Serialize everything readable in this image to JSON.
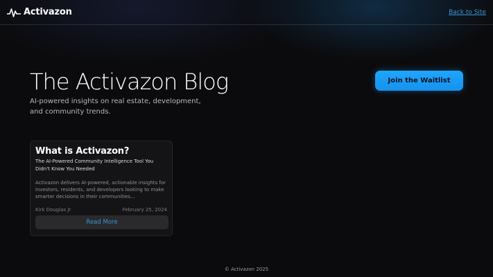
{
  "header": {
    "brand_name": "Activazon",
    "logo_icon": "pulse-wave-icon",
    "back_link": "Back to Site"
  },
  "hero": {
    "title": "The Activazon Blog",
    "subtitle": "AI-powered insights on real estate, development, and community trends.",
    "cta_label": "Join the Waitlist"
  },
  "posts": [
    {
      "title": "What is Activazon?",
      "subtitle": "The AI-Powered Community Intelligence Tool You Didn't Know You Needed",
      "excerpt": "Activazon delivers AI-powered, actionable insights for investors, residents, and developers looking to make smarter decisions in their communities...",
      "author": "Kirk Douglas Jr",
      "date": "February 25, 2024",
      "read_more_label": "Read More"
    }
  ],
  "footer": {
    "copyright": "© Activazon 2025"
  },
  "colors": {
    "background": "#0b0b0d",
    "accent": "#1fa6ff",
    "link": "#3b95d6",
    "card": "#141416"
  }
}
